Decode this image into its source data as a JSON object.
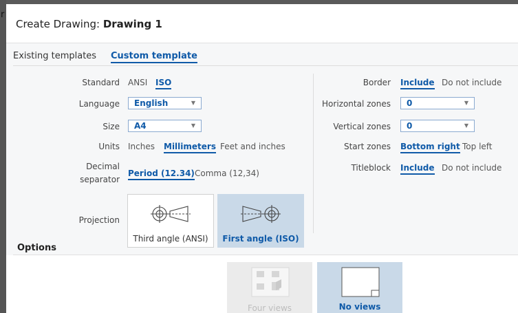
{
  "background": {
    "char": "r"
  },
  "dialog": {
    "title_prefix": "Create Drawing:",
    "title_name": "Drawing 1"
  },
  "tabs": [
    "Existing templates",
    "Custom template"
  ],
  "form": {
    "standard": {
      "label": "Standard",
      "options": [
        "ANSI",
        "ISO"
      ],
      "selected": "ISO"
    },
    "language": {
      "label": "Language",
      "value": "English"
    },
    "size": {
      "label": "Size",
      "value": "A4"
    },
    "units": {
      "label": "Units",
      "options": [
        "Inches",
        "Millimeters",
        "Feet and inches"
      ],
      "selected": "Millimeters"
    },
    "decimal": {
      "label_line1": "Decimal",
      "label_line2": "separator",
      "options": [
        "Period (12.34)",
        "Comma (12,34)"
      ],
      "selected": "Period (12.34)"
    },
    "projection": {
      "label": "Projection",
      "options": [
        "Third angle (ANSI)",
        "First angle (ISO)"
      ],
      "selected": "First angle (ISO)"
    },
    "border": {
      "label": "Border",
      "options": [
        "Include",
        "Do not include"
      ],
      "selected": "Include"
    },
    "horizontal_zones": {
      "label": "Horizontal zones",
      "value": "0"
    },
    "vertical_zones": {
      "label": "Vertical zones",
      "value": "0"
    },
    "start_zones": {
      "label": "Start zones",
      "options": [
        "Bottom right",
        "Top left"
      ],
      "selected": "Bottom right"
    },
    "titleblock": {
      "label": "Titleblock",
      "options": [
        "Include",
        "Do not include"
      ],
      "selected": "Include"
    }
  },
  "options": {
    "title": "Options",
    "views": [
      "Four views",
      "No views"
    ],
    "selected": "No views"
  },
  "colors": {
    "accent": "#0f5aa8",
    "selected_card": "#c9d9e8",
    "disabled_card": "#ebebeb"
  }
}
